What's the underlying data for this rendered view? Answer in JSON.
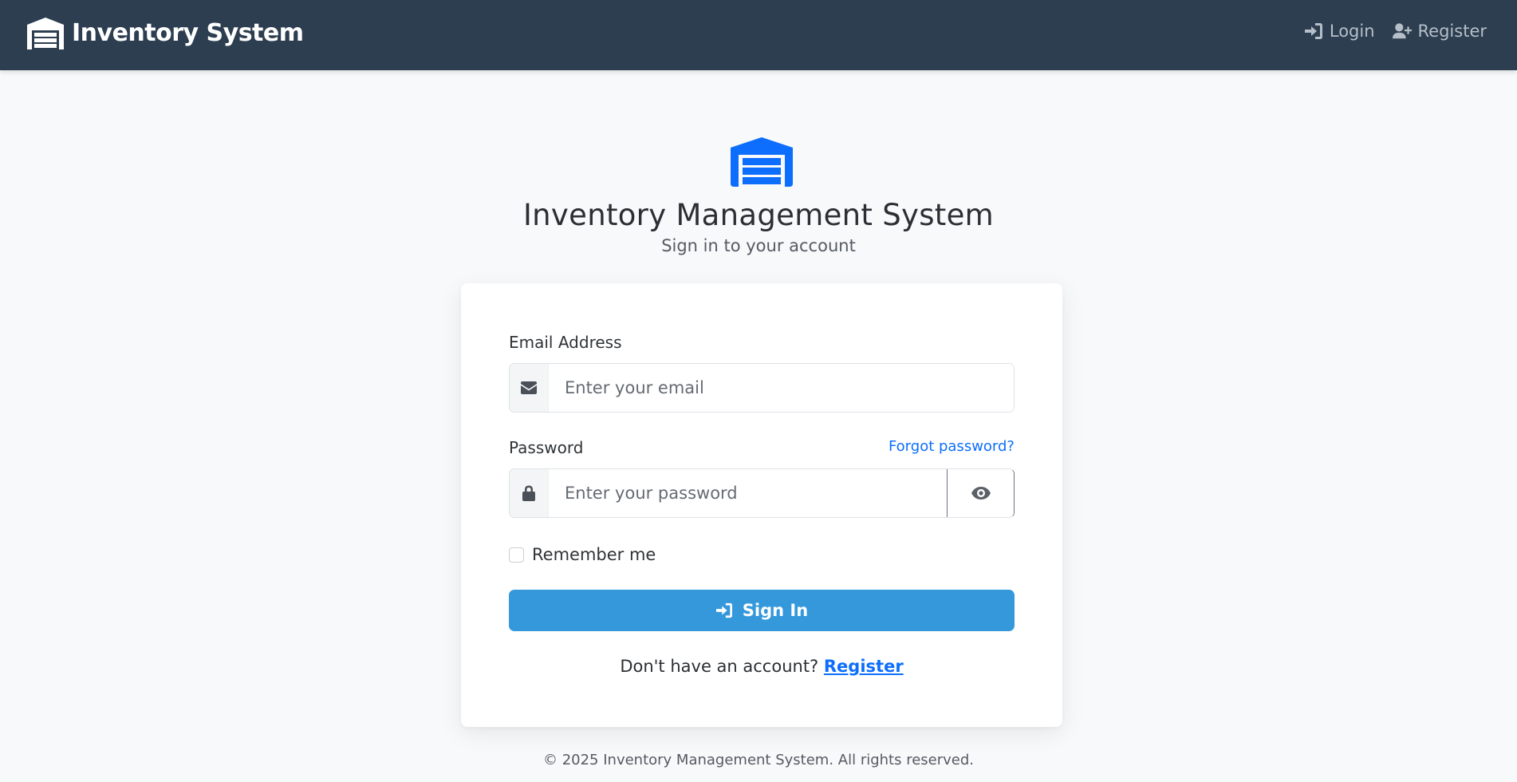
{
  "navbar": {
    "brand": "Inventory System",
    "links": [
      {
        "label": "Login",
        "icon": "sign-in-icon"
      },
      {
        "label": "Register",
        "icon": "user-plus-icon"
      }
    ],
    "background": "#2c3e50"
  },
  "header": {
    "title": "Inventory Management System",
    "subtitle": "Sign in to your account",
    "logo_icon": "warehouse-icon",
    "accent": "#0d6efd"
  },
  "form": {
    "email_label": "Email Address",
    "email_placeholder": "Enter your email",
    "password_label": "Password",
    "password_placeholder": "Enter your password",
    "forgot_link": "Forgot password?",
    "remember_label": "Remember me",
    "submit_label": "Sign In",
    "submit_color": "#3498db",
    "no_account_text": "Don't have an account?",
    "register_link": "Register"
  },
  "footer": {
    "text": "© 2025 Inventory Management System. All rights reserved."
  }
}
